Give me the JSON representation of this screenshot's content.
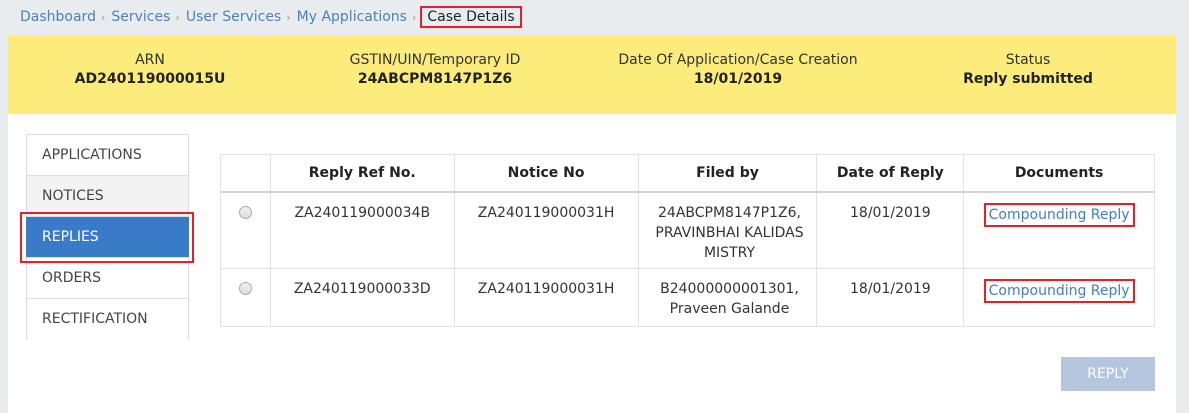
{
  "breadcrumb": {
    "items": [
      "Dashboard",
      "Services",
      "User Services",
      "My Applications"
    ],
    "current": "Case Details",
    "separator": "›"
  },
  "banner": {
    "arn_label": "ARN",
    "arn_value": "AD240119000015U",
    "gstin_label": "GSTIN/UIN/Temporary ID",
    "gstin_value": "24ABCPM8147P1Z6",
    "date_label": "Date Of Application/Case Creation",
    "date_value": "18/01/2019",
    "status_label": "Status",
    "status_value": "Reply submitted"
  },
  "sidenav": {
    "items": [
      "APPLICATIONS",
      "NOTICES",
      "REPLIES",
      "ORDERS",
      "RECTIFICATION"
    ],
    "active": "REPLIES"
  },
  "table": {
    "headers": [
      "",
      "Reply Ref No.",
      "Notice No",
      "Filed by",
      "Date of Reply",
      "Documents"
    ],
    "rows": [
      {
        "reply_ref": "ZA240119000034B",
        "notice_no": "ZA240119000031H",
        "filed_by": "24ABCPM8147P1Z6, PRAVINBHAI KALIDAS MISTRY",
        "date": "18/01/2019",
        "document": "Compounding Reply"
      },
      {
        "reply_ref": "ZA240119000033D",
        "notice_no": "ZA240119000031H",
        "filed_by": "B24000000001301, Praveen Galande",
        "date": "18/01/2019",
        "document": "Compounding Reply"
      }
    ]
  },
  "reply_button": "REPLY",
  "colors": {
    "banner_bg": "#fbec7c",
    "active_nav": "#3a7bc8",
    "link": "#4b82b8",
    "highlight_border": "#e4212b",
    "disabled_button": "#b4c6dd"
  }
}
